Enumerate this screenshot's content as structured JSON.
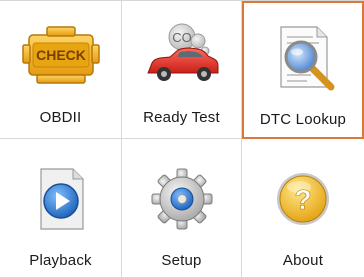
{
  "menu": {
    "tiles": [
      {
        "label": "OBDII",
        "icon": "check-engine-icon"
      },
      {
        "label": "Ready Test",
        "icon": "car-emissions-icon"
      },
      {
        "label": "DTC Lookup",
        "icon": "document-search-icon",
        "selected": true
      },
      {
        "label": "Playback",
        "icon": "playback-icon"
      },
      {
        "label": "Setup",
        "icon": "gear-icon"
      },
      {
        "label": "About",
        "icon": "help-icon"
      }
    ],
    "check_engine_text": "CHECK",
    "co_text": "CO",
    "question_mark": "?"
  },
  "colors": {
    "selected_border": "#d97a3a",
    "engine_yellow": "#f2b320",
    "car_red": "#e03a2b",
    "help_gold": "#f2b81c"
  }
}
